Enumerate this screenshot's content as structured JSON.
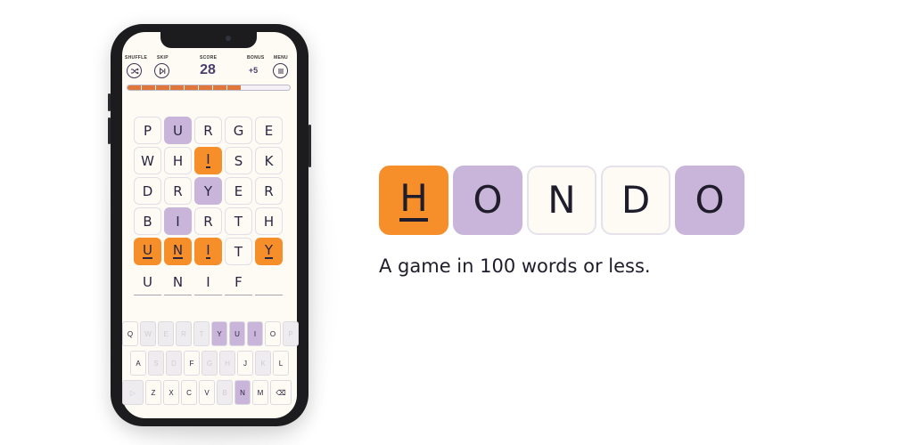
{
  "top_bar": {
    "shuffle_label": "SHUFFLE",
    "skip_label": "SKIP",
    "score_label": "SCORE",
    "bonus_label": "BONUS",
    "menu_label": "MENU",
    "score_value": "28",
    "bonus_value": "+5"
  },
  "progress": {
    "filled_fraction": 0.7
  },
  "grid": [
    [
      {
        "l": "P",
        "s": "plain"
      },
      {
        "l": "U",
        "s": "purple"
      },
      {
        "l": "R",
        "s": "plain"
      },
      {
        "l": "G",
        "s": "plain"
      },
      {
        "l": "E",
        "s": "plain"
      }
    ],
    [
      {
        "l": "W",
        "s": "plain"
      },
      {
        "l": "H",
        "s": "plain"
      },
      {
        "l": "I",
        "s": "orange-u"
      },
      {
        "l": "S",
        "s": "plain"
      },
      {
        "l": "K",
        "s": "plain"
      }
    ],
    [
      {
        "l": "D",
        "s": "plain"
      },
      {
        "l": "R",
        "s": "plain"
      },
      {
        "l": "Y",
        "s": "purple"
      },
      {
        "l": "E",
        "s": "plain"
      },
      {
        "l": "R",
        "s": "plain"
      }
    ],
    [
      {
        "l": "B",
        "s": "plain"
      },
      {
        "l": "I",
        "s": "purple"
      },
      {
        "l": "R",
        "s": "plain"
      },
      {
        "l": "T",
        "s": "plain"
      },
      {
        "l": "H",
        "s": "plain"
      }
    ],
    [
      {
        "l": "U",
        "s": "orange-u"
      },
      {
        "l": "N",
        "s": "orange-u"
      },
      {
        "l": "I",
        "s": "orange-u"
      },
      {
        "l": "T",
        "s": "plain"
      },
      {
        "l": "Y",
        "s": "orange-u"
      }
    ]
  ],
  "current_entry": [
    "U",
    "N",
    "I",
    "F",
    ""
  ],
  "keyboard": {
    "rows": [
      [
        {
          "k": "Q",
          "s": "normal"
        },
        {
          "k": "W",
          "s": "used"
        },
        {
          "k": "E",
          "s": "used"
        },
        {
          "k": "R",
          "s": "used"
        },
        {
          "k": "T",
          "s": "used"
        },
        {
          "k": "Y",
          "s": "hit"
        },
        {
          "k": "U",
          "s": "hit"
        },
        {
          "k": "I",
          "s": "hit"
        },
        {
          "k": "O",
          "s": "normal"
        },
        {
          "k": "P",
          "s": "used"
        }
      ],
      [
        {
          "k": "A",
          "s": "normal"
        },
        {
          "k": "S",
          "s": "used"
        },
        {
          "k": "D",
          "s": "used"
        },
        {
          "k": "F",
          "s": "normal"
        },
        {
          "k": "G",
          "s": "used"
        },
        {
          "k": "H",
          "s": "used"
        },
        {
          "k": "J",
          "s": "normal"
        },
        {
          "k": "K",
          "s": "used"
        },
        {
          "k": "L",
          "s": "normal"
        }
      ],
      [
        {
          "k": "▷",
          "s": "used"
        },
        {
          "k": "Z",
          "s": "normal"
        },
        {
          "k": "X",
          "s": "normal"
        },
        {
          "k": "C",
          "s": "normal"
        },
        {
          "k": "V",
          "s": "normal"
        },
        {
          "k": "B",
          "s": "used"
        },
        {
          "k": "N",
          "s": "hit"
        },
        {
          "k": "M",
          "s": "normal"
        },
        {
          "k": "⌫",
          "s": "normal"
        }
      ]
    ]
  },
  "logo": {
    "letters": [
      {
        "l": "H",
        "s": "orange-u"
      },
      {
        "l": "O",
        "s": "purple"
      },
      {
        "l": "N",
        "s": "plain"
      },
      {
        "l": "D",
        "s": "plain"
      },
      {
        "l": "O",
        "s": "purple"
      }
    ]
  },
  "tagline": "A game in 100 words or less.",
  "colors": {
    "orange": "#f68e2a",
    "purple": "#c8b5d9",
    "ink": "#2a2540",
    "progress": "#e0773a"
  }
}
